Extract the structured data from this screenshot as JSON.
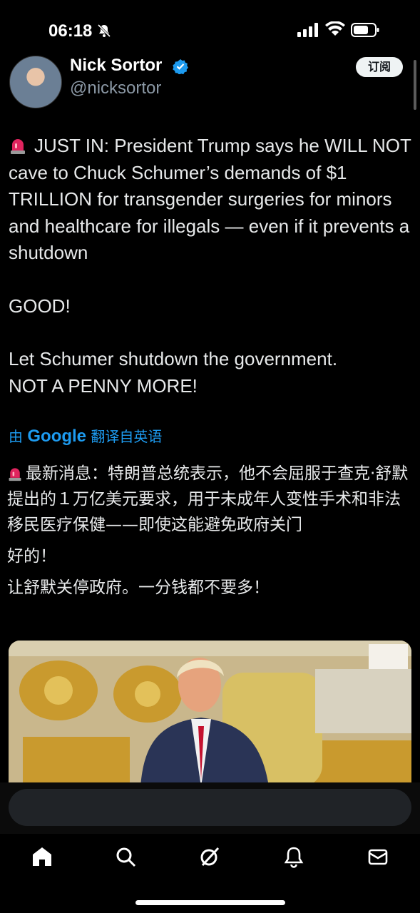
{
  "status": {
    "time": "06:18"
  },
  "header": {
    "name": "Nick Sortor",
    "handle": "@nicksortor",
    "subscribe_label": "订阅"
  },
  "tweet": {
    "line1": "JUST IN: President Trump says he WILL NOT cave to Chuck Schumer’s demands of $1 TRILLION for transgender surgeries for minors and healthcare for illegals — even if it prevents a shutdown",
    "line2": "GOOD!",
    "line3": "Let Schumer shutdown the government.",
    "line4": "NOT A PENNY MORE!"
  },
  "translation": {
    "prefix": "由",
    "provider": "Google",
    "suffix": "翻译自英语",
    "text1": "最新消息：特朗普总统表示，他不会屈服于查克·舒默提出的１万亿美元要求，用于未成年人变性手术和非法移民医疗保健——即使这能避免政府关门",
    "text2": "好的！",
    "text3": "让舒默关停政府。一分钱都不要多！"
  },
  "reply": {
    "placeholder": ""
  },
  "nav": {
    "items": [
      "home-icon",
      "search-icon",
      "grok-icon",
      "notifications-icon",
      "messages-icon"
    ]
  },
  "colors": {
    "accent": "#1d9bf0",
    "background": "#000000"
  }
}
